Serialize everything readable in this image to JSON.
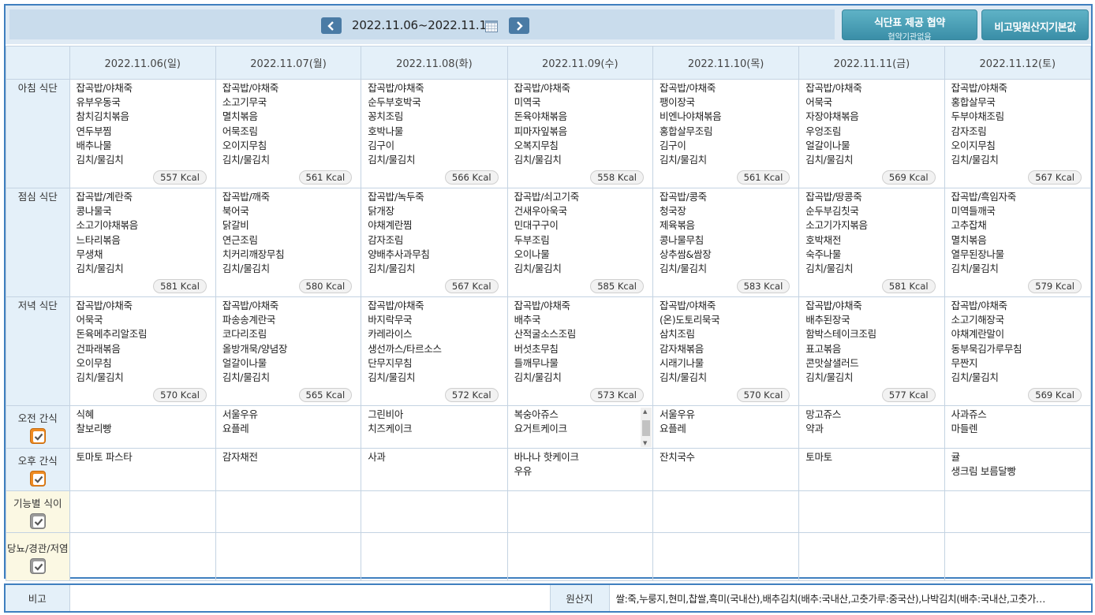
{
  "header": {
    "date_range": "2022.11.06~2022.11.12",
    "agree_button_title": "식단표 제공 협약",
    "agree_button_subtitle": "협약기관없음",
    "note_button_label": "비고및원산지기본값"
  },
  "days": [
    {
      "label": "2022.11.06(일)",
      "type": "sun"
    },
    {
      "label": "2022.11.07(월)",
      "type": "weekday"
    },
    {
      "label": "2022.11.08(화)",
      "type": "weekday"
    },
    {
      "label": "2022.11.09(수)",
      "type": "weekday"
    },
    {
      "label": "2022.11.10(목)",
      "type": "weekday"
    },
    {
      "label": "2022.11.11(금)",
      "type": "weekday"
    },
    {
      "label": "2022.11.12(토)",
      "type": "sat"
    }
  ],
  "meals": [
    {
      "label": "아침 식단",
      "cells": [
        {
          "items": [
            "잡곡밥/야채죽",
            "유부우동국",
            "참치김치볶음",
            "연두부찜",
            "배추나물",
            "김치/물김치"
          ],
          "kcal": "557 Kcal"
        },
        {
          "items": [
            "잡곡밥/야채죽",
            "소고기무국",
            "멸치볶음",
            "어묵조림",
            "오이지무침",
            "김치/물김치"
          ],
          "kcal": "561 Kcal"
        },
        {
          "items": [
            "잡곡밥/야채죽",
            "순두부호박국",
            "꽁치조림",
            "호박나물",
            "김구이",
            "김치/물김치"
          ],
          "kcal": "566 Kcal"
        },
        {
          "items": [
            "잡곡밥/야채죽",
            "미역국",
            "돈육야채볶음",
            "피마자잎볶음",
            "오복지무침",
            "김치/물김치"
          ],
          "kcal": "558 Kcal"
        },
        {
          "items": [
            "잡곡밥/야채죽",
            "팽이장국",
            "비엔나야채볶음",
            "홍합살무조림",
            "김구이",
            "김치/물김치"
          ],
          "kcal": "561 Kcal"
        },
        {
          "items": [
            "잡곡밥/야채죽",
            "어묵국",
            "자장야채볶음",
            "우엉조림",
            "얼갈이나물",
            "김치/물김치"
          ],
          "kcal": "569 Kcal"
        },
        {
          "items": [
            "잡곡밥/야채죽",
            "홍합살무국",
            "두부야채조림",
            "감자조림",
            "오이지무침",
            "김치/물김치"
          ],
          "kcal": "567 Kcal"
        }
      ]
    },
    {
      "label": "점심 식단",
      "cells": [
        {
          "items": [
            "잡곡밥/계란죽",
            "콩나물국",
            "소고기야채볶음",
            "느타리볶음",
            "무생채",
            "김치/물김치"
          ],
          "kcal": "581 Kcal"
        },
        {
          "items": [
            "잡곡밥/깨죽",
            "북어국",
            "닭갈비",
            "연근조림",
            "치커리깨장무침",
            "김치/물김치"
          ],
          "kcal": "580 Kcal"
        },
        {
          "items": [
            "잡곡밥/녹두죽",
            "닭개장",
            "야채계란찜",
            "감자조림",
            "양배추사과무침",
            "김치/물김치"
          ],
          "kcal": "567 Kcal"
        },
        {
          "items": [
            "잡곡밥/쇠고기죽",
            "건새우아욱국",
            "민대구구이",
            "두부조림",
            "오이나물",
            "김치/물김치"
          ],
          "kcal": "585 Kcal"
        },
        {
          "items": [
            "잡곡밥/콩죽",
            "청국장",
            "제육볶음",
            "콩나물무침",
            "상추쌈&쌈장",
            "김치/물김치"
          ],
          "kcal": "583 Kcal"
        },
        {
          "items": [
            "잡곡밥/땅콩죽",
            "순두부김칫국",
            "소고기가지볶음",
            "호박채전",
            "숙주나물",
            "김치/물김치"
          ],
          "kcal": "581 Kcal"
        },
        {
          "items": [
            "잡곡밥/흑임자죽",
            "미역들깨국",
            "고추잡채",
            "멸치볶음",
            "열무된장나물",
            "김치/물김치"
          ],
          "kcal": "579 Kcal"
        }
      ]
    },
    {
      "label": "저녁 식단",
      "cells": [
        {
          "items": [
            "잡곡밥/야채죽",
            "어묵국",
            "돈육메추리알조림",
            "건파래볶음",
            "오이무침",
            "김치/물김치"
          ],
          "kcal": "570 Kcal"
        },
        {
          "items": [
            "잡곡밥/야채죽",
            "파송송계란국",
            "코다리조림",
            "올방개묵/양념장",
            "얼갈이나물",
            "김치/물김치"
          ],
          "kcal": "565 Kcal"
        },
        {
          "items": [
            "잡곡밥/야채죽",
            "바지락무국",
            "카레라이스",
            "생선까스/타르소스",
            "단무지무침",
            "김치/물김치"
          ],
          "kcal": "572 Kcal"
        },
        {
          "items": [
            "잡곡밥/야채죽",
            "배추국",
            "산적굴소스조림",
            "버섯초무침",
            "들깨무나물",
            "김치/물김치"
          ],
          "kcal": "573 Kcal"
        },
        {
          "items": [
            "잡곡밥/야채죽",
            "(온)도토리묵국",
            "삼치조림",
            "감자채볶음",
            "시래기나물",
            "김치/물김치"
          ],
          "kcal": "570 Kcal"
        },
        {
          "items": [
            "잡곡밥/야채죽",
            "배추된장국",
            "함박스테이크조림",
            "표고볶음",
            "콘맛살샐러드",
            "김치/물김치"
          ],
          "kcal": "577 Kcal"
        },
        {
          "items": [
            "잡곡밥/야채죽",
            "소고기해장국",
            "야채계란말이",
            "동부묵김가루무침",
            "무짠지",
            "김치/물김치"
          ],
          "kcal": "569 Kcal"
        }
      ]
    }
  ],
  "snacks": [
    {
      "label": "오전 간식",
      "checkbox": "orange",
      "cells": [
        [
          "식혜",
          "찰보리빵"
        ],
        [
          "서울우유",
          "요플레"
        ],
        [
          "그린비아",
          "치즈케이크"
        ],
        [
          "복숭아쥬스",
          "요거트케이크"
        ],
        [
          "서울우유",
          "요플레"
        ],
        [
          "망고쥬스",
          "약과"
        ],
        [
          "사과쥬스",
          "마들렌"
        ]
      ]
    },
    {
      "label": "오후 간식",
      "checkbox": "orange",
      "cells": [
        [
          "토마토 파스타"
        ],
        [
          "감자채전"
        ],
        [
          "사과"
        ],
        [
          "바나나 핫케이크",
          "우유"
        ],
        [
          "잔치국수"
        ],
        [
          "토마토"
        ],
        [
          "귤",
          "생크림 보름달빵"
        ]
      ]
    },
    {
      "label": "기능별 식이",
      "checkbox": "grey",
      "cells": [
        [],
        [],
        [],
        [],
        [],
        [],
        []
      ]
    },
    {
      "label": "당뇨/경관/저염",
      "checkbox": "grey",
      "cells": [
        [],
        [],
        [],
        [],
        [],
        [],
        []
      ]
    }
  ],
  "footer": {
    "note_label": "비고",
    "note_value": "",
    "origin_label": "원산지",
    "origin_value": "쌀:죽,누룽지,현미,찹쌀,흑미(국내산),배추김치(배추:국내산,고춧가루:중국산),나박김치(배추:국내산,고춧가…"
  }
}
